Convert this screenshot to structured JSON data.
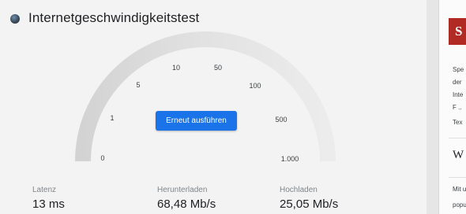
{
  "speedtest": {
    "title": "Internetgeschwindigkeitstest",
    "gauge": {
      "scale_labels": [
        "0",
        "1",
        "5",
        "10",
        "50",
        "100",
        "500",
        "1.000"
      ]
    },
    "rerun_button_label": "Erneut ausführen",
    "metrics": [
      {
        "label": "Latenz",
        "value": "13 ms"
      },
      {
        "label": "Herunterladen",
        "value": "68,48 Mb/s"
      },
      {
        "label": "Hochladen",
        "value": "25,05 Mb/s"
      }
    ]
  },
  "side_panel": {
    "badge": "S",
    "lines": [
      "Spe",
      "der",
      "Inte",
      "F ..",
      "Tex"
    ],
    "w_glyph": "W",
    "footer_lines": [
      "Mit u",
      "popu"
    ]
  },
  "colors": {
    "accent": "#1a73e8",
    "gauge_track": "#dedede",
    "badge": "#b12a24"
  }
}
